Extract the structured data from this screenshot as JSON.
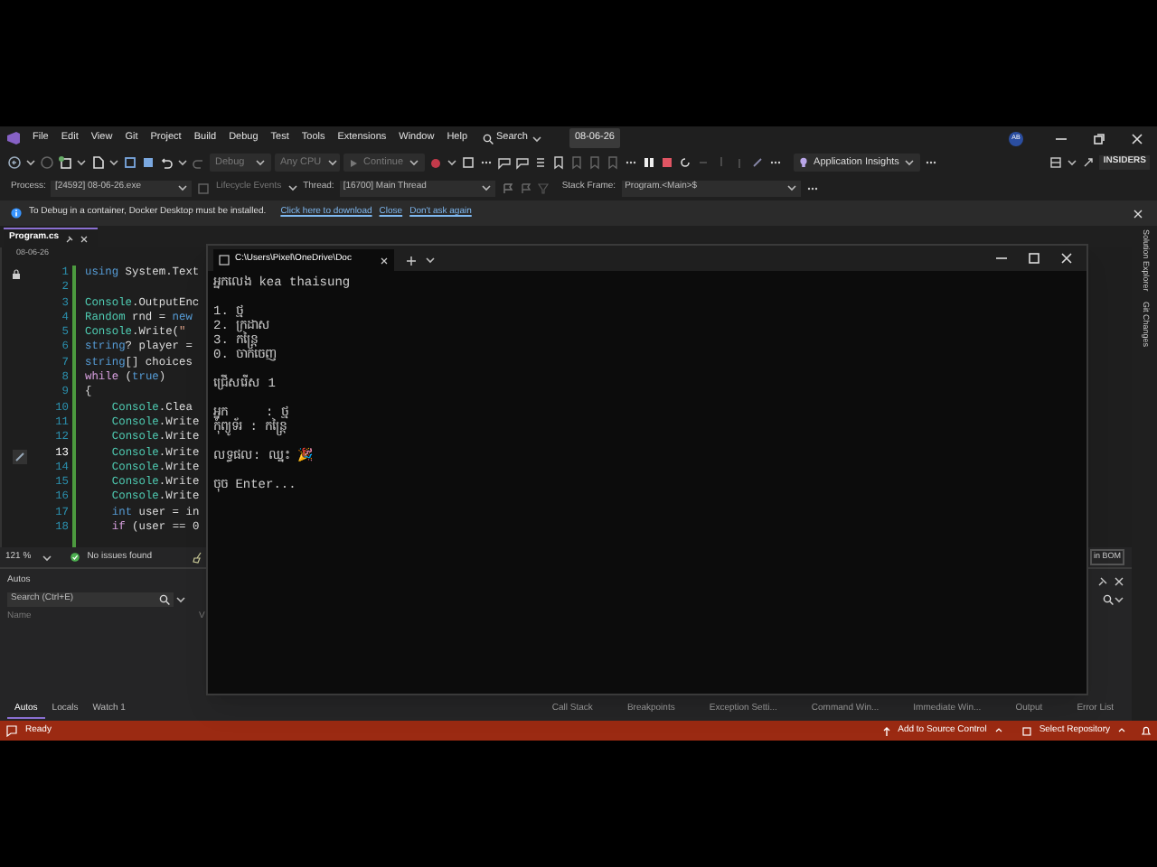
{
  "menu_bar": {
    "items": [
      "File",
      "Edit",
      "View",
      "Git",
      "Project",
      "Build",
      "Debug",
      "Test",
      "Tools",
      "Extensions",
      "Window",
      "Help"
    ],
    "search": "Search",
    "solution_badge": "08-06-26",
    "avatar": "AB"
  },
  "toolbar": {
    "configuration": {
      "label": "Debug",
      "disabled": true
    },
    "platform": {
      "label": "Any CPU",
      "disabled": true
    },
    "continue": {
      "label": "Continue",
      "disabled": true
    },
    "insights": "Application Insights",
    "insiders": "INSIDERS"
  },
  "debug_location": {
    "process_label": "Process:",
    "process": "[24592] 08-06-26.exe",
    "lifecycle": "Lifecycle Events",
    "thread_label": "Thread:",
    "thread": "[16700] Main Thread",
    "stack_label": "Stack Frame:",
    "stack_frame": "Program.<Main>$"
  },
  "info_bar": {
    "message": "To Debug in a container, Docker Desktop must be installed.",
    "links": [
      "Click here to download",
      "Close",
      "Don't ask again"
    ]
  },
  "editor": {
    "tab": "Program.cs",
    "nav": "08-06-26",
    "lines": [
      {
        "number": "1",
        "current": false,
        "tokens": [
          {
            "text": "using",
            "kind": "keyword"
          },
          {
            "text": " System.Text",
            "kind": "plain"
          }
        ]
      },
      {
        "number": "2",
        "current": false
      },
      {
        "number": "3",
        "current": false,
        "tokens": [
          {
            "text": "Console",
            "kind": "type"
          },
          {
            "text": ".OutputEnc",
            "kind": "plain"
          }
        ]
      },
      {
        "number": "4",
        "current": false,
        "tokens": [
          {
            "text": "Random",
            "kind": "type"
          },
          {
            "text": " rnd = ",
            "kind": "plain"
          },
          {
            "text": "new",
            "kind": "keyword"
          }
        ]
      },
      {
        "number": "5",
        "current": false,
        "tokens": [
          {
            "text": "Console",
            "kind": "type"
          },
          {
            "text": ".Write(",
            "kind": "plain"
          },
          {
            "text": "\"",
            "kind": "string"
          }
        ]
      },
      {
        "number": "6",
        "current": false,
        "tokens": [
          {
            "text": "string",
            "kind": "keyword"
          },
          {
            "text": "? player =",
            "kind": "plain"
          }
        ]
      },
      {
        "number": "7",
        "current": false,
        "tokens": [
          {
            "text": "string",
            "kind": "keyword"
          },
          {
            "text": "[] choices",
            "kind": "plain"
          }
        ]
      },
      {
        "number": "8",
        "current": false,
        "tokens": [
          {
            "text": "while",
            "kind": "control"
          },
          {
            "text": " (",
            "kind": "plain"
          },
          {
            "text": "true",
            "kind": "keyword"
          },
          {
            "text": ")",
            "kind": "plain"
          }
        ]
      },
      {
        "number": "9",
        "current": false,
        "tokens": [
          {
            "text": "{",
            "kind": "plain"
          }
        ],
        "children": [
          {
            "number": "10",
            "current": false,
            "tokens": [
              {
                "text": "Console",
                "kind": "type"
              },
              {
                "text": ".Clea",
                "kind": "plain"
              }
            ]
          },
          {
            "number": "11",
            "current": false,
            "tokens": [
              {
                "text": "Console",
                "kind": "type"
              },
              {
                "text": ".Write",
                "kind": "plain"
              }
            ]
          },
          {
            "number": "12",
            "current": false,
            "tokens": [
              {
                "text": "Console",
                "kind": "type"
              },
              {
                "text": ".Write",
                "kind": "plain"
              }
            ]
          },
          {
            "number": "13",
            "current": true,
            "tokens": [
              {
                "text": "Console",
                "kind": "type"
              },
              {
                "text": ".Write",
                "kind": "plain"
              }
            ]
          },
          {
            "number": "14",
            "current": false,
            "tokens": [
              {
                "text": "Console",
                "kind": "type"
              },
              {
                "text": ".Write",
                "kind": "plain"
              }
            ]
          },
          {
            "number": "15",
            "current": false,
            "tokens": [
              {
                "text": "Console",
                "kind": "type"
              },
              {
                "text": ".Write",
                "kind": "plain"
              }
            ]
          },
          {
            "number": "16",
            "current": false,
            "tokens": [
              {
                "text": "Console",
                "kind": "type"
              },
              {
                "text": ".Write",
                "kind": "plain"
              }
            ]
          },
          {
            "number": "17",
            "current": false,
            "tokens": [
              {
                "text": "int",
                "kind": "keyword"
              },
              {
                "text": " user = in",
                "kind": "plain"
              }
            ]
          },
          {
            "number": "18",
            "current": false,
            "tokens": [
              {
                "text": "if",
                "kind": "control"
              },
              {
                "text": " (user == 0",
                "kind": "plain"
              }
            ]
          }
        ]
      }
    ],
    "zoom": "121 %",
    "issues": "No issues found",
    "encoding": "in BOM"
  },
  "autos": {
    "title": "Autos",
    "search_placeholder": "Search (Ctrl+E)",
    "columns": [
      "Name",
      "V"
    ]
  },
  "bottom_tabs_left": [
    {
      "label": "Autos",
      "selected": true
    },
    {
      "label": "Locals",
      "selected": false
    },
    {
      "label": "Watch 1",
      "selected": false
    }
  ],
  "bottom_tabs_right": [
    "Call Stack",
    "Breakpoints",
    "Exception Setti...",
    "Command Win...",
    "Immediate Win...",
    "Output",
    "Error List"
  ],
  "side_tabs": [
    "Solution Explorer",
    "Git Changes"
  ],
  "console": {
    "tab_title": "C:\\Users\\Pixel\\OneDrive\\Doc",
    "groups": [
      [
        "អ្នកលេង kea thaisung"
      ],
      [
        "1. ថ្ម",
        "2. ក្រដាស",
        "3. កន្ត្រៃ",
        "0. ចាកចេញ"
      ],
      [
        "ជ្រើសរើស 1"
      ],
      [
        "អ្នក     : ថ្ម",
        "កុំព្យូទ័រ : កន្ត្រៃ"
      ],
      [
        "លទ្ធផល: ឈ្នះ 🎉"
      ],
      [
        "ចុច Enter..."
      ]
    ]
  },
  "status_bar": {
    "state": "Ready",
    "source_control": "Add to Source Control",
    "repository": "Select Repository"
  }
}
